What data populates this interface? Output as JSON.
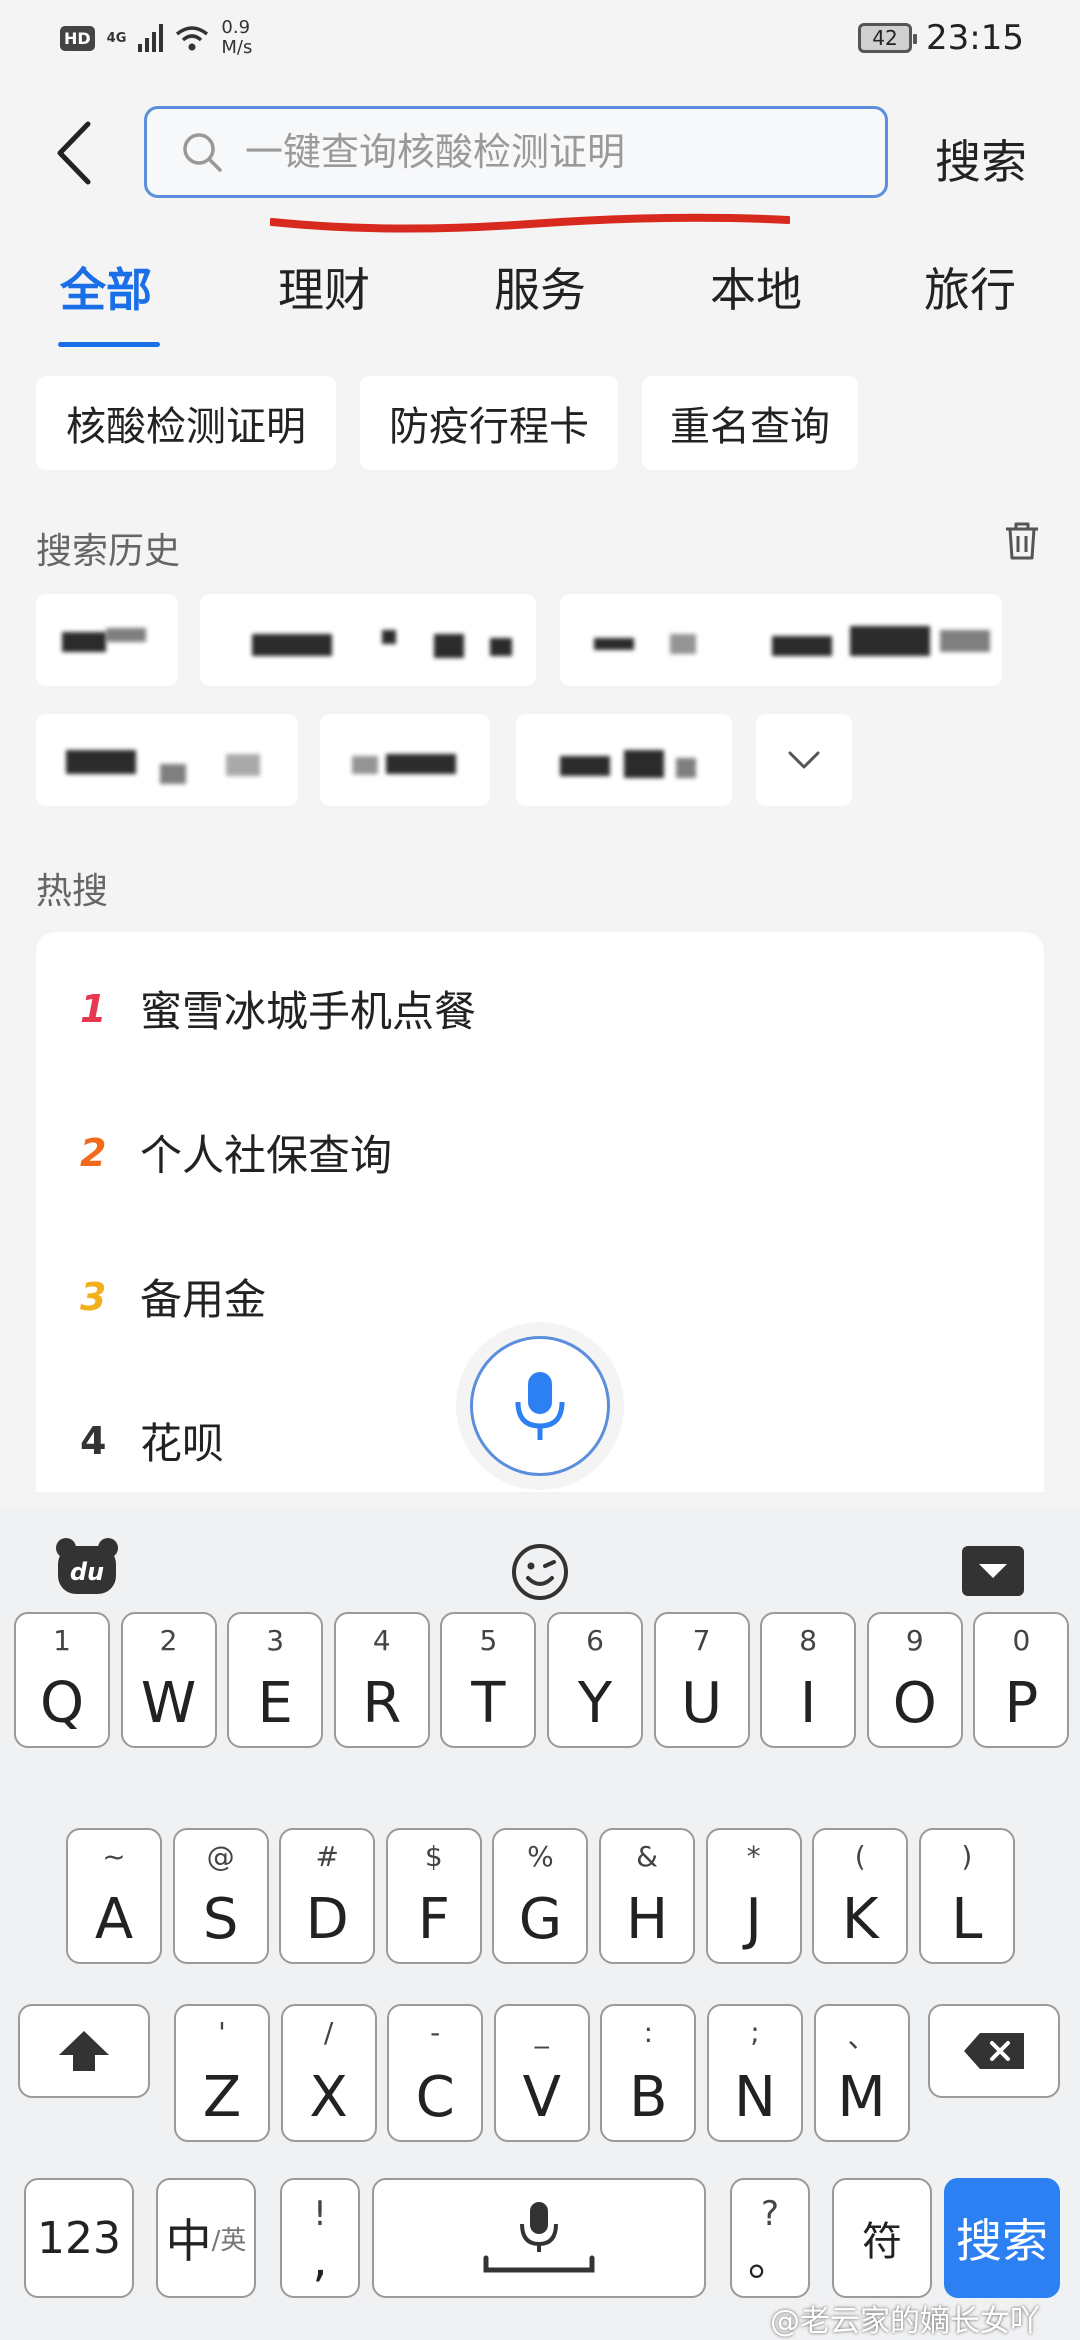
{
  "status_bar": {
    "hd": "HD",
    "network": "4G",
    "speed_value": "0.9",
    "speed_unit": "M/s",
    "battery": "42",
    "time": "23:15"
  },
  "header": {
    "search_placeholder": "一键查询核酸检测证明",
    "search_button": "搜索"
  },
  "tabs": [
    {
      "label": "全部",
      "active": true
    },
    {
      "label": "理财"
    },
    {
      "label": "服务"
    },
    {
      "label": "本地"
    },
    {
      "label": "旅行"
    }
  ],
  "quick_chips": [
    "核酸检测证明",
    "防疫行程卡",
    "重名查询"
  ],
  "history": {
    "title": "搜索历史"
  },
  "hot": {
    "title": "热搜",
    "items": [
      {
        "rank": "1",
        "text": "蜜雪冰城手机点餐",
        "color": "#e8384f"
      },
      {
        "rank": "2",
        "text": "个人社保查询",
        "color": "#f26b1d"
      },
      {
        "rank": "3",
        "text": "备用金",
        "color": "#f2b01d"
      },
      {
        "rank": "4",
        "text": "花呗",
        "color": "#333333"
      }
    ]
  },
  "keyboard": {
    "row1": [
      {
        "sub": "1",
        "main": "Q"
      },
      {
        "sub": "2",
        "main": "W"
      },
      {
        "sub": "3",
        "main": "E"
      },
      {
        "sub": "4",
        "main": "R"
      },
      {
        "sub": "5",
        "main": "T"
      },
      {
        "sub": "6",
        "main": "Y"
      },
      {
        "sub": "7",
        "main": "U"
      },
      {
        "sub": "8",
        "main": "I"
      },
      {
        "sub": "9",
        "main": "O"
      },
      {
        "sub": "0",
        "main": "P"
      }
    ],
    "row2": [
      {
        "sub": "~",
        "main": "A"
      },
      {
        "sub": "@",
        "main": "S"
      },
      {
        "sub": "#",
        "main": "D"
      },
      {
        "sub": "$",
        "main": "F"
      },
      {
        "sub": "%",
        "main": "G"
      },
      {
        "sub": "&",
        "main": "H"
      },
      {
        "sub": "*",
        "main": "J"
      },
      {
        "sub": "(",
        "main": "K"
      },
      {
        "sub": ")",
        "main": "L"
      }
    ],
    "row3": [
      {
        "sub": "'",
        "main": "Z"
      },
      {
        "sub": "/",
        "main": "X"
      },
      {
        "sub": "-",
        "main": "C"
      },
      {
        "sub": "_",
        "main": "V"
      },
      {
        "sub": ":",
        "main": "B"
      },
      {
        "sub": ";",
        "main": "N"
      },
      {
        "sub": "、",
        "main": "M"
      }
    ],
    "num_key": "123",
    "lang_main": "中",
    "lang_sub": "/英",
    "punct_top": "!",
    "punct_bottom": ",",
    "punct2_top": "?",
    "punct2_bottom": "。",
    "symbol_key": "符",
    "search_key": "搜索"
  },
  "watermark": "@老云家的嫡长女吖",
  "colors": {
    "accent": "#1a6ee6",
    "search_border": "#5b8edc",
    "keyboard_action": "#2d80f2"
  }
}
